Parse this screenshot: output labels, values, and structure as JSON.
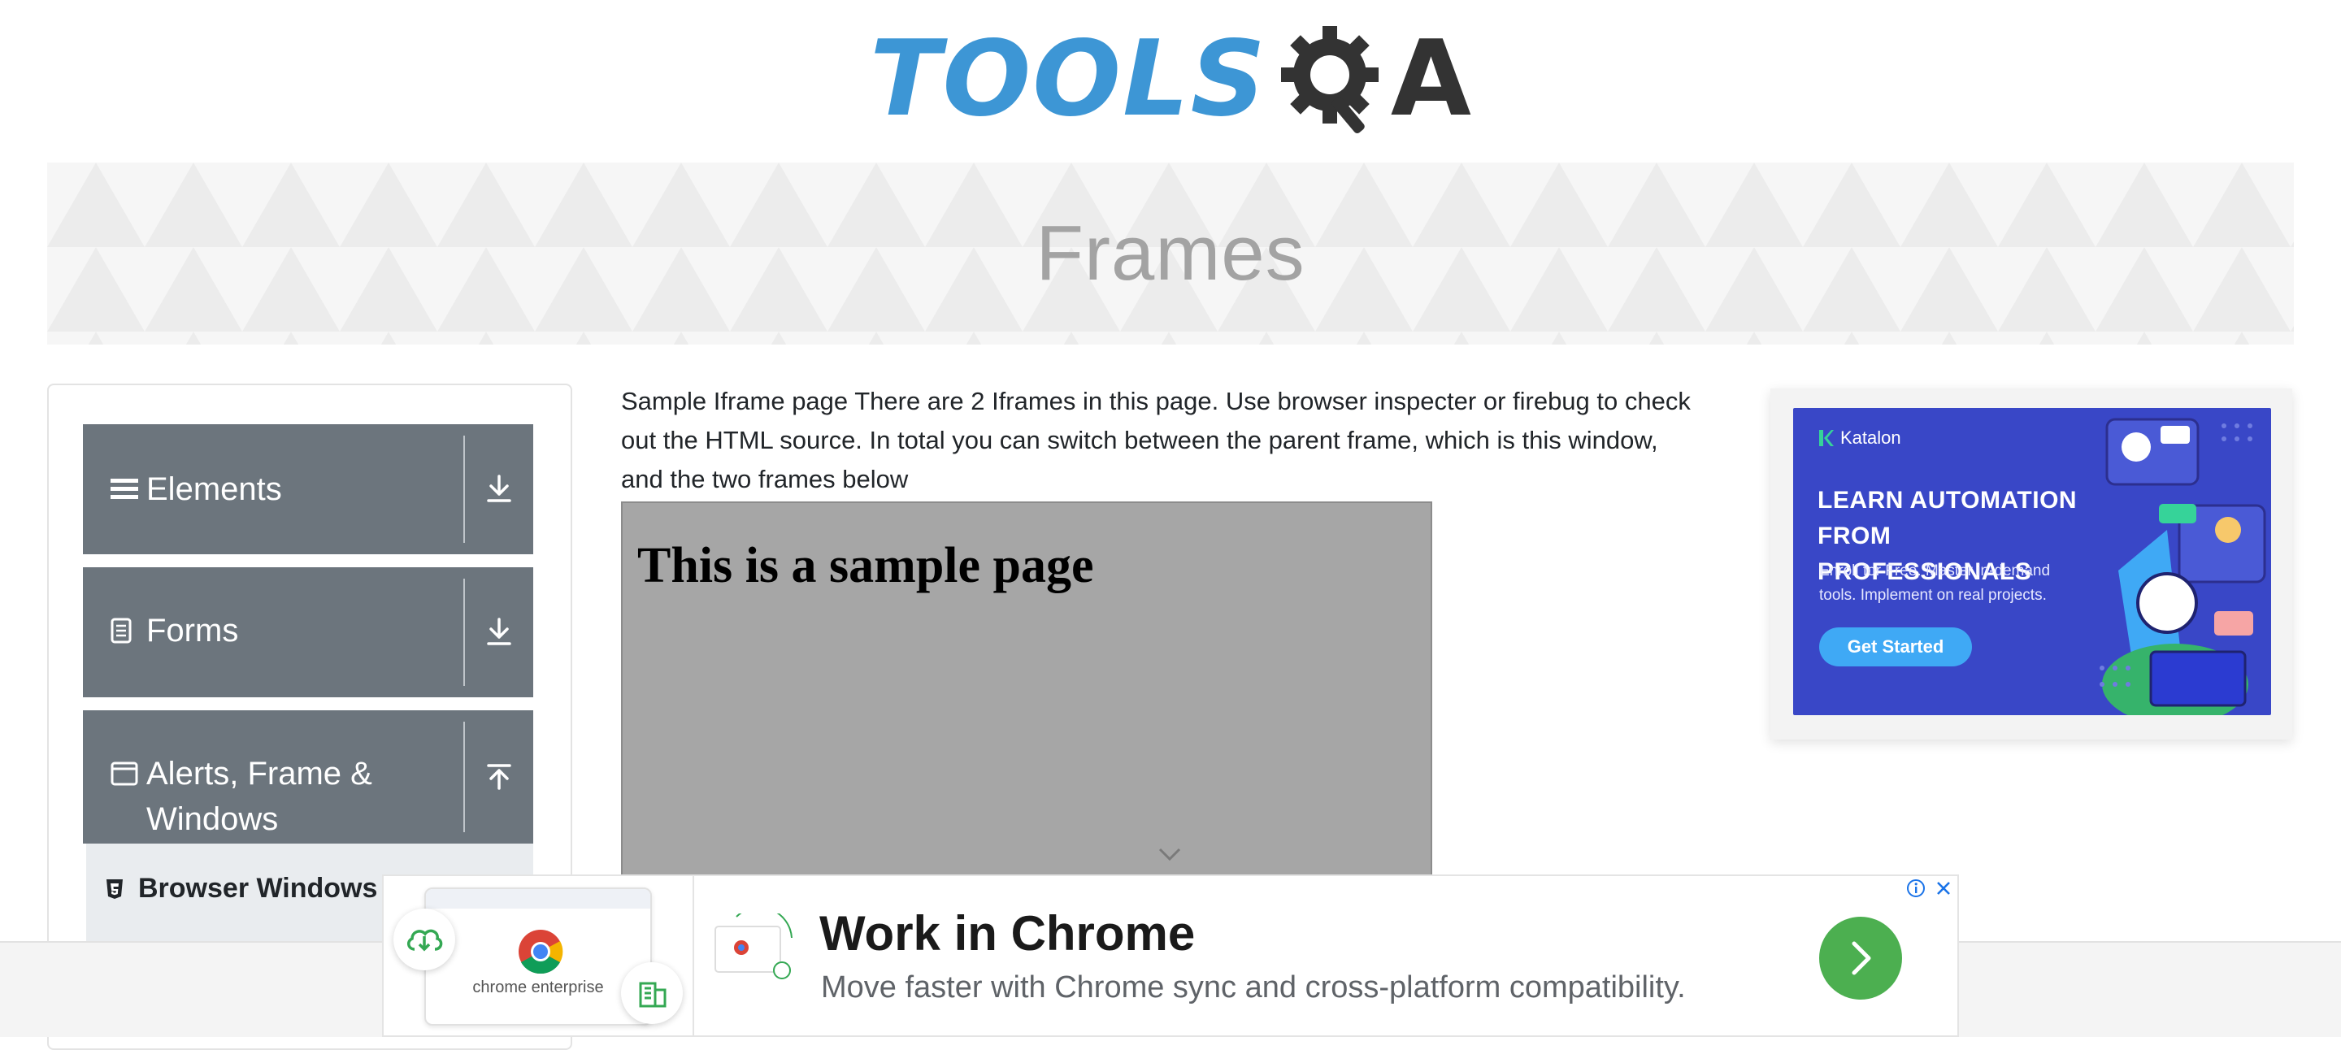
{
  "header": {
    "logo_text": "TOOLS",
    "logo_suffix": "A"
  },
  "banner": {
    "title": "Frames"
  },
  "sidebar": {
    "groups": [
      {
        "label": "Elements",
        "icon": "hamburger-icon",
        "arrow": "download-arrow-icon"
      },
      {
        "label": "Forms",
        "icon": "document-icon",
        "arrow": "download-arrow-icon"
      },
      {
        "label": "Alerts, Frame & Windows",
        "icon": "window-icon",
        "arrow": "upload-arrow-icon"
      }
    ],
    "sub_items": [
      {
        "label": "Browser Windows",
        "icon": "html5-icon"
      }
    ]
  },
  "main": {
    "intro": "Sample Iframe page There are 2 Iframes in this page. Use browser inspecter or firebug to check out the HTML source. In total you can switch between the parent frame, which is this window, and the two frames below",
    "frame": {
      "heading": "This is a sample page"
    }
  },
  "right_ad": {
    "brand": "Katalon",
    "headline": "LEARN AUTOMATION FROM PROFESSIONALS",
    "subtext": "Enroll for Free. Master in-demand tools. Implement on real projects.",
    "cta": "Get Started",
    "colors": {
      "background": "#3947c7",
      "cta": "#3fa9f5"
    }
  },
  "bottom_ad": {
    "thumb_caption": "chrome enterprise",
    "title": "Work in Chrome",
    "description": "Move faster with Chrome sync and cross-platform compatibility.",
    "colors": {
      "go_button": "#4caf50"
    }
  }
}
